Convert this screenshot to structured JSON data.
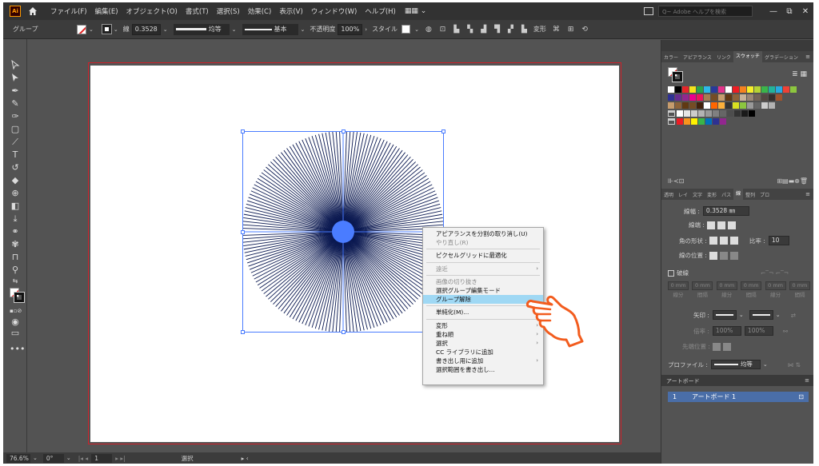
{
  "app": {
    "logo_text": "Ai",
    "menus": [
      "ファイル(F)",
      "編集(E)",
      "オブジェクト(O)",
      "書式(T)",
      "選択(S)",
      "効果(C)",
      "表示(V)",
      "ウィンドウ(W)",
      "ヘルプ(H)"
    ],
    "search_placeholder": "Q~ Adobe ヘルプを検索",
    "window_buttons": [
      "—",
      "⧉",
      "✕"
    ]
  },
  "control_bar": {
    "selection_label": "グループ",
    "stroke_label": "線",
    "stroke_weight": "0.3528",
    "profile_label": "均等",
    "brush_label": "基本",
    "opacity_label": "不透明度",
    "opacity_value": "100%",
    "style_label": "スタイル",
    "transform_label": "変形"
  },
  "context_menu": {
    "items": [
      {
        "label": "アピアランスを分割の取り消し(U)",
        "disabled": false,
        "submenu": false
      },
      {
        "label": "やり直し(R)",
        "disabled": true,
        "submenu": false
      },
      {
        "sep": true
      },
      {
        "label": "ピクセルグリッドに最適化",
        "disabled": false,
        "submenu": false
      },
      {
        "sep": true
      },
      {
        "label": "遠近",
        "disabled": true,
        "submenu": true
      },
      {
        "sep": true
      },
      {
        "label": "画像の切り抜き",
        "disabled": true,
        "submenu": false
      },
      {
        "label": "選択グループ編集モード",
        "disabled": false,
        "submenu": false
      },
      {
        "label": "グループ解除",
        "disabled": false,
        "submenu": false,
        "highlight": true
      },
      {
        "sep": true
      },
      {
        "label": "単純化(M)...",
        "disabled": false,
        "submenu": false
      },
      {
        "sep": true
      },
      {
        "label": "変形",
        "disabled": false,
        "submenu": true
      },
      {
        "label": "重ね順",
        "disabled": false,
        "submenu": true
      },
      {
        "label": "選択",
        "disabled": false,
        "submenu": true
      },
      {
        "label": "CC ライブラリに追加",
        "disabled": false,
        "submenu": false
      },
      {
        "label": "書き出し用に追加",
        "disabled": false,
        "submenu": true
      },
      {
        "label": "選択範囲を書き出し...",
        "disabled": false,
        "submenu": false
      }
    ]
  },
  "swatches_panel": {
    "tabs": [
      "カラー",
      "アピアランス",
      "リンク",
      "スウォッチ",
      "グラデーション"
    ],
    "active_tab": "スウォッチ"
  },
  "stroke_panel": {
    "tabs": [
      "透明",
      "レイ",
      "文字",
      "変形",
      "パス",
      "線",
      "整列",
      "プロ"
    ],
    "weight_label": "線幅 :",
    "weight_value": "0.3528 ㎜",
    "cap_label": "線端 :",
    "corner_label": "角の形状 :",
    "limit_label": "比率 :",
    "limit_value": "10",
    "align_label": "線の位置 :",
    "dashed_label": "破線",
    "dash_labels": [
      "線分",
      "間隔",
      "線分",
      "間隔",
      "線分",
      "間隔"
    ],
    "dash_values": [
      "0 mm",
      "0 mm",
      "0 mm",
      "0 mm",
      "0 mm",
      "0 mm"
    ],
    "arrow_label": "矢印 :",
    "scale_label": "倍率 :",
    "scale_values": [
      "100%",
      "100%"
    ],
    "align_arrow_label": "先端位置 :",
    "profile_label": "プロファイル :",
    "profile_value": "均等"
  },
  "artboards_panel": {
    "title": "アートボード",
    "row_number": "1",
    "row_name": "アートボード 1"
  },
  "status_bar": {
    "zoom": "76.6%",
    "rotation": "0°",
    "artboard_num": "1",
    "tool": "選択"
  },
  "colors": {
    "selection_blue": "#4a7cff",
    "menu_highlight": "#9fd8f4",
    "hand_orange": "#f25c1e",
    "artboard_border": "#d0202a"
  }
}
